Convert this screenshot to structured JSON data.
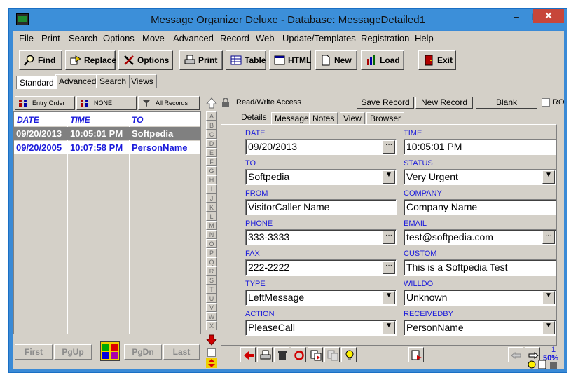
{
  "window": {
    "title": "Message Organizer Deluxe - Database: MessageDetailed1",
    "minimize": "–",
    "maximize": "□",
    "close": "✕"
  },
  "menu": [
    "File",
    "Print",
    "Search",
    "Options",
    "Move",
    "Advanced",
    "Record",
    "Web",
    "Update/Templates",
    "Registration",
    "Help"
  ],
  "toolbar": {
    "find": "Find",
    "replace": "Replace",
    "options": "Options",
    "print": "Print",
    "table": "Table",
    "html": "HTML",
    "new": "New",
    "load": "Load",
    "exit": "Exit"
  },
  "view_tabs": [
    "Standard",
    "Advanced",
    "Search",
    "Views"
  ],
  "sort_buttons": {
    "entry_order": "Entry Order",
    "none": "NONE",
    "all_records": "All Records"
  },
  "grid": {
    "columns": [
      "DATE",
      "TIME",
      "TO"
    ],
    "rows": [
      {
        "date": "09/20/2013",
        "time": "10:05:01 PM",
        "to": "Softpedia",
        "selected": true
      },
      {
        "date": "09/20/2005",
        "time": "10:07:58 PM",
        "to": "PersonName",
        "selected": false
      }
    ]
  },
  "nav": {
    "first": "First",
    "pgup": "PgUp",
    "pgdn": "PgDn",
    "last": "Last"
  },
  "alphabet": [
    "A",
    "B",
    "C",
    "D",
    "E",
    "F",
    "G",
    "H",
    "I",
    "J",
    "K",
    "L",
    "M",
    "N",
    "O",
    "P",
    "Q",
    "R",
    "S",
    "T",
    "U",
    "V",
    "W",
    "X"
  ],
  "right_top": {
    "status": "Read/Write Access",
    "save": "Save Record",
    "new": "New Record",
    "blank": "Blank",
    "ro": "RO"
  },
  "detail_tabs": [
    "Details",
    "Message",
    "Notes",
    "View",
    "Browser"
  ],
  "fields": {
    "date": {
      "label": "DATE",
      "value": "09/20/2013"
    },
    "time": {
      "label": "TIME",
      "value": "10:05:01 PM"
    },
    "to": {
      "label": "TO",
      "value": "Softpedia"
    },
    "status": {
      "label": "STATUS",
      "value": "Very Urgent"
    },
    "from": {
      "label": "FROM",
      "value": "VisitorCaller Name"
    },
    "company": {
      "label": "COMPANY",
      "value": "Company Name"
    },
    "phone": {
      "label": "PHONE",
      "value": "333-3333"
    },
    "email": {
      "label": "EMAIL",
      "value": "test@softpedia.com"
    },
    "fax": {
      "label": "FAX",
      "value": "222-2222"
    },
    "custom": {
      "label": "CUSTOM",
      "value": "This is a Softpedia Test"
    },
    "type": {
      "label": "TYPE",
      "value": "LeftMessage"
    },
    "willdo": {
      "label": "WILLDO",
      "value": "Unknown"
    },
    "action": {
      "label": "ACTION",
      "value": "PleaseCall"
    },
    "receivedby": {
      "label": "RECEIVEDBY",
      "value": "PersonName"
    }
  },
  "record_info": {
    "count": "1",
    "percent": "50%"
  },
  "colors": {
    "titlebar": "#3c8fd9",
    "accent_blue": "#1a1adb",
    "selected_row": "#808080",
    "close_red": "#c7463a"
  }
}
